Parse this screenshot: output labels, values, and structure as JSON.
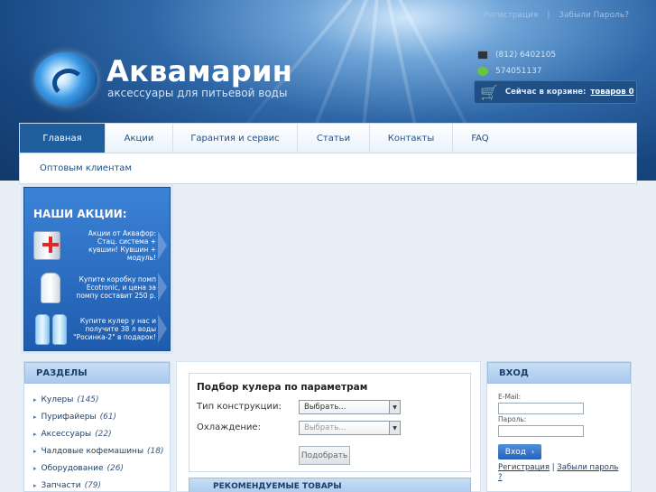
{
  "header": {
    "top_links": {
      "register": "Регистрация",
      "separator": "|",
      "forgot": "Забыли Пароль?"
    },
    "brand": "Аквамарин",
    "tagline": "аксессуары для питьевой воды",
    "phone": "(812) 6402105",
    "icq": "574051137",
    "cart": {
      "label": "Сейчас в корзине:",
      "count": "товаров 0"
    }
  },
  "nav": {
    "tabs": [
      {
        "label": "Главная",
        "active": true
      },
      {
        "label": "Акции"
      },
      {
        "label": "Гарантия и сервис"
      },
      {
        "label": "Статьи"
      },
      {
        "label": "Контакты"
      },
      {
        "label": "FAQ"
      }
    ],
    "sub": "Оптовым клиентам"
  },
  "promo": {
    "title": "НАШИ АКЦИИ:",
    "items": [
      "Акции от Аквафор: Стац. система + кувшин! Кувшин + модуль!",
      "Купите коробку помп Ecotronic, и цена за помпу составит 250 р.",
      "Купите кулер у нас и получите 38 л воды \"Росинка-2\" в подарок!"
    ]
  },
  "sections": {
    "title": "РАЗДЕЛЫ",
    "items": [
      {
        "label": "Кулеры",
        "count": "(145)"
      },
      {
        "label": "Пурифайеры",
        "count": "(61)"
      },
      {
        "label": "Аксессуары",
        "count": "(22)"
      },
      {
        "label": "Чалдовые кофемашины",
        "count": "(18)"
      },
      {
        "label": "Оборудование",
        "count": "(26)"
      },
      {
        "label": "Запчасти",
        "count": "(79)"
      }
    ]
  },
  "selector": {
    "title": "Подбор кулера по параметрам",
    "type_label": "Тип конструкции:",
    "type_value": "Выбрать...",
    "cooling_label": "Охлаждение:",
    "cooling_value": "Выбрать...",
    "button": "Подобрать"
  },
  "recommended": "РЕКОМЕНДУЕМЫЕ ТОВАРЫ",
  "login": {
    "title": "ВХОД",
    "email_label": "E-Mail:",
    "password_label": "Пароль:",
    "button": "Вход",
    "register": "Регистрация",
    "sep": "|",
    "forgot": "Забыли пароль ?"
  },
  "colors": {
    "nav_active": "#1f5d9c",
    "accent": "#2563b7",
    "panel_head": "#a9c9ec"
  },
  "icons": [
    "phone-icon",
    "icq-icon",
    "cart-icon",
    "chevron-right-icon",
    "dropdown-arrow-icon"
  ]
}
